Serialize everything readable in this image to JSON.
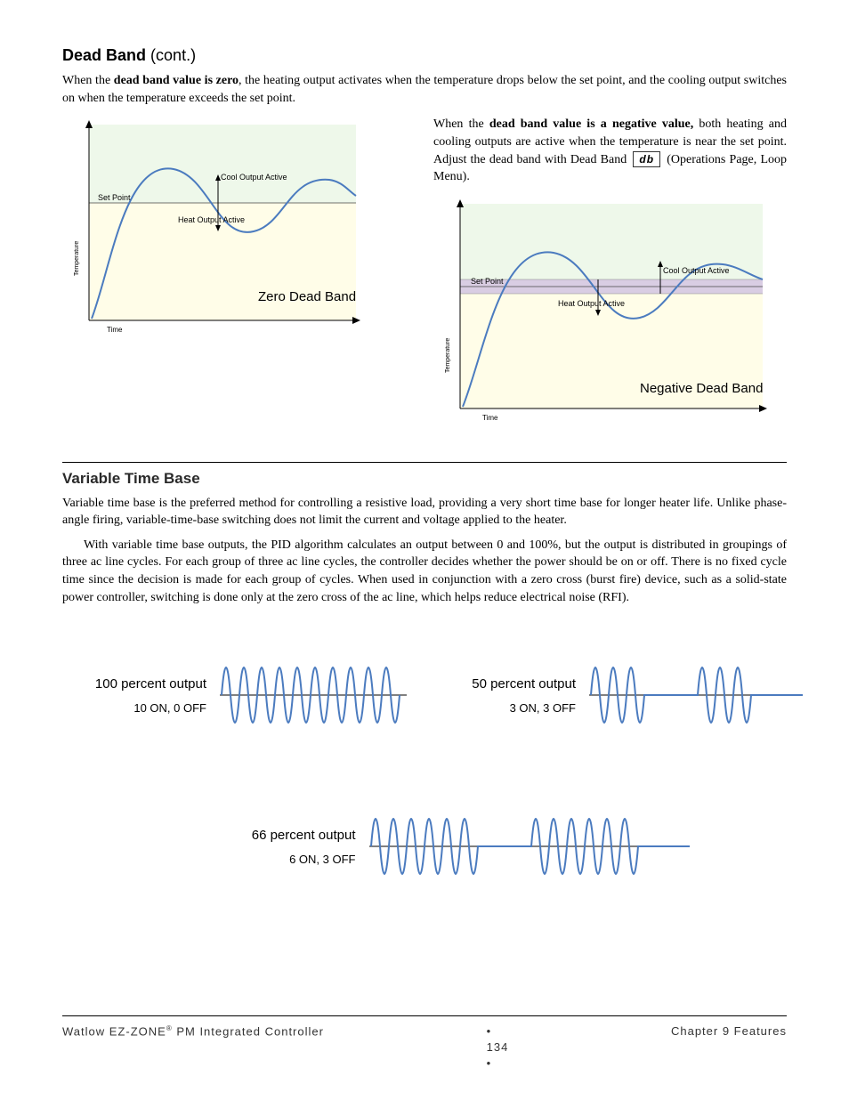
{
  "header": {
    "title": "Dead Band",
    "cont": "(cont.)"
  },
  "para1_a": "When the ",
  "para1_b": "dead band value is zero",
  "para1_c": ", the heating output activates when the temperature drops below the set point, and the cooling output switches on when the temperature exceeds the set point.",
  "para2_a": "When the ",
  "para2_b": "dead band value is a negative value,",
  "para2_c": " both heating and cooling outputs are active when the temperature is near the set point. Adjust the dead band with Dead Band ",
  "para2_d": "db",
  "para2_e": " (Operations Page, Loop Menu).",
  "chart_labels": {
    "set_point": "Set Point",
    "cool": "Cool Output Active",
    "heat": "Heat Output Active",
    "zero_title": "Zero Dead Band",
    "neg_title": "Negative Dead Band",
    "time": "Time",
    "temp": "Temperature"
  },
  "vtb_title": "Variable Time Base",
  "vtb_p1": "Variable time base is the preferred method for controlling a resistive load, providing a very short time base for longer heater life. Unlike phase-angle firing, variable-time-base switching does not limit the current and voltage applied to the heater.",
  "vtb_p2": "With variable time base outputs, the PID algorithm calculates an output between 0 and 100%, but the output is distributed in groupings of three ac line cycles. For each group of three ac line cycles, the controller decides whether the power should be on or off. There is no fixed cycle time since the decision is made for each group of cycles. When used in conjunction with a zero cross (burst fire) device, such as a solid-state power controller, switching is done only at the zero cross of the ac line, which helps reduce electrical noise (RFI).",
  "waves": {
    "w100_title": "100 percent output",
    "w100_sub": "10 ON, 0 OFF",
    "w50_title": "50 percent output",
    "w50_sub": "3 ON, 3 OFF",
    "w66_title": "66 percent output",
    "w66_sub": "6 ON, 3 OFF"
  },
  "footer": {
    "left_a": "Watlow EZ-ZONE",
    "left_b": " PM Integrated Controller",
    "center": "134",
    "right": "Chapter 9 Features"
  },
  "chart_data": [
    {
      "type": "line",
      "title": "Zero Dead Band",
      "xlabel": "Time",
      "ylabel": "Temperature",
      "description": "Process temperature curve rising past Set Point and oscillating. Above set point: Cool Output Active. Below set point: Heat Output Active. Dead band width = 0."
    },
    {
      "type": "line",
      "title": "Negative Dead Band",
      "xlabel": "Time",
      "ylabel": "Temperature",
      "description": "Same curve. Overlapping bands around set point where both Cool and Heat outputs activate. Negative dead band shown as overlapping shaded region."
    },
    {
      "type": "waveform",
      "title": "100 percent output",
      "pattern": "10 ON, 0 OFF",
      "cycles": [
        1,
        1,
        1,
        1,
        1,
        1,
        1,
        1,
        1,
        1
      ]
    },
    {
      "type": "waveform",
      "title": "50 percent output",
      "pattern": "3 ON, 3 OFF",
      "cycles": [
        1,
        1,
        1,
        0,
        0,
        0,
        1,
        1,
        1,
        0,
        0,
        0
      ]
    },
    {
      "type": "waveform",
      "title": "66 percent output",
      "pattern": "6 ON, 3 OFF",
      "cycles": [
        1,
        1,
        1,
        1,
        1,
        1,
        0,
        0,
        0,
        1,
        1,
        1,
        1,
        1,
        1,
        0,
        0,
        0
      ]
    }
  ]
}
